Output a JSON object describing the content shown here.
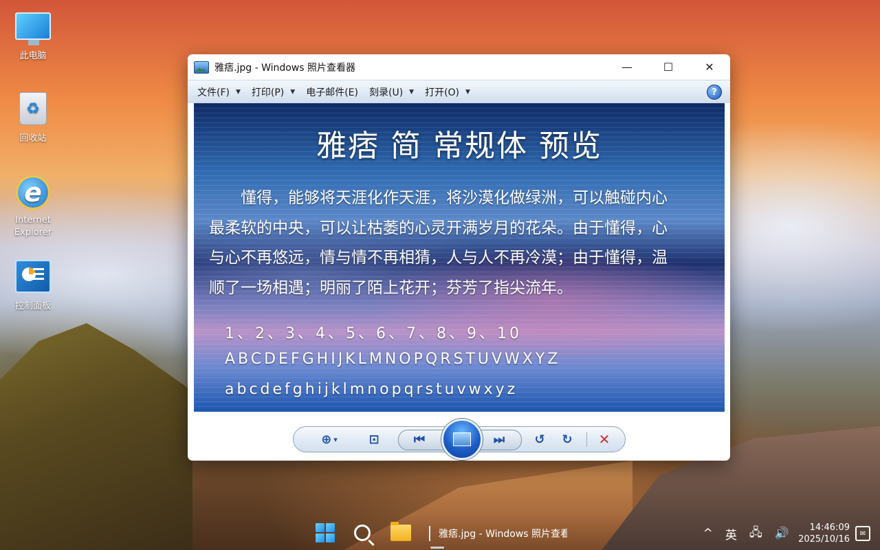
{
  "desktop": {
    "icons": [
      {
        "label": "此电脑",
        "icon": "computer-icon"
      },
      {
        "label": "回收站",
        "icon": "recycle-bin-icon"
      },
      {
        "label": "Internet Explorer",
        "icon": "internet-explorer-icon"
      },
      {
        "label": "控制面板",
        "icon": "control-panel-icon"
      }
    ]
  },
  "window": {
    "title": "雅痞.jpg - Windows 照片查看器",
    "controls": {
      "minimize": "—",
      "maximize": "☐",
      "close": "✕"
    },
    "menu": [
      {
        "label": "文件(F)",
        "has_dropdown": true
      },
      {
        "label": "打印(P)",
        "has_dropdown": true
      },
      {
        "label": "电子邮件(E)",
        "has_dropdown": false
      },
      {
        "label": "刻录(U)",
        "has_dropdown": true
      },
      {
        "label": "打开(O)",
        "has_dropdown": true
      }
    ],
    "help_label": "?",
    "caret": "▼"
  },
  "photo": {
    "title": "雅痞 简 常规体 预览",
    "paragraph_lines": [
      "　　懂得，能够将天涯化作天涯，将沙漠化做绿洲，可以触碰内心",
      "最柔软的中央，可以让枯萎的心灵开满岁月的花朵。由于懂得，心",
      "与心不再悠远，情与情不再相猜，人与人不再冷漠；由于懂得，温",
      "顺了一场相遇；明丽了陌上花开；芬芳了指尖流年。"
    ],
    "numbers": "1、2、3、4、5、6、7、8、9、10",
    "uppercase": "ABCDEFGHIJKLMNOPQRSTUVWXYZ",
    "lowercase": "abcdefghijklmnopqrstuvwxyz"
  },
  "toolbar": {
    "zoom": "⊕",
    "zoom_caret": "▾",
    "fit": "⊡",
    "prev": "⏮",
    "next": "⏭",
    "rotate_ccw": "↺",
    "rotate_cw": "↻",
    "delete": "✕"
  },
  "taskbar": {
    "app_title": "雅痞.jpg - Windows 照片查看器",
    "tray": {
      "chevron": "^",
      "ime": "英",
      "network": "🖧",
      "volume": "🔊",
      "time": "14:46:09",
      "date": "2025/10/16",
      "notification": "✉"
    }
  },
  "colors": {
    "menu_text": "#1a1a1a",
    "toolbar_icon": "#1f4fa8",
    "delete_icon": "#d32f2f",
    "photo_text": "#ffffff"
  }
}
